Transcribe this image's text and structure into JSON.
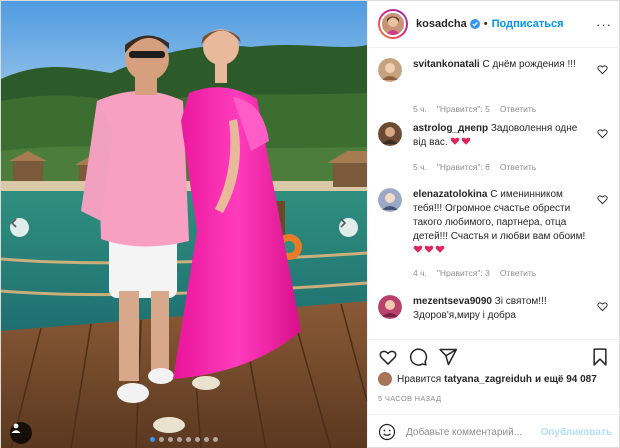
{
  "post": {
    "username": "kosadcha",
    "follow_label": "Подписаться",
    "separator": "•",
    "more_label": "···",
    "carousel_dot_count": 8,
    "carousel_active_index": 0
  },
  "comments": [
    {
      "username": "svitankonatali",
      "text": "С днём рождения !!!",
      "hearts": 0,
      "time": "5 ч.",
      "likes": "\"Нравится\": 5",
      "reply": "Ответить"
    },
    {
      "username": "astrolog_днепр",
      "text": "Задоволення одне від вас.",
      "hearts": 2,
      "time": "5 ч.",
      "likes": "\"Нравится\": 6",
      "reply": "Ответить"
    },
    {
      "username": "elenazatolokina",
      "text": "С именинником тебя!!! Огромное счастье обрести такого любимого, партнера, отца детей!!! Счастья и любви вам обоим!",
      "hearts": 3,
      "time": "4 ч.",
      "likes": "\"Нравится\": 3",
      "reply": "Ответить"
    },
    {
      "username": "mezentseva9090",
      "text": "Зі святом!!! Здоров'я,миру і добра",
      "hearts": 0,
      "time": "",
      "likes": "",
      "reply": ""
    }
  ],
  "likes": {
    "prefix": "Нравится",
    "user": "tatyana_zagreiduh",
    "suffix": "и ещё 94 087"
  },
  "timestamp": "5 ЧАСОВ НАЗАД",
  "add_comment": {
    "placeholder": "Добавьте комментарий...",
    "publish_label": "Опубликовать"
  },
  "colors": {
    "accent": "#0095f6",
    "publish_disabled": "#b2dffc",
    "dress": "#ff2fb4",
    "heart": "#e0245e"
  }
}
